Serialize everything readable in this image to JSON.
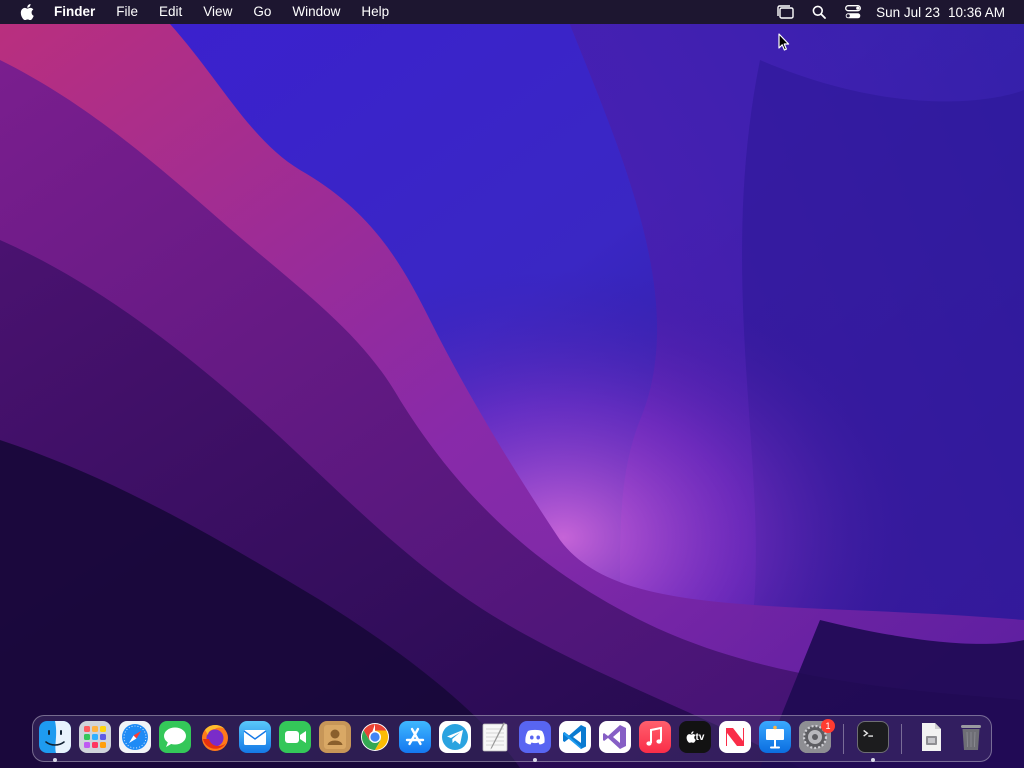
{
  "menubar": {
    "app_name": "Finder",
    "menus": [
      "File",
      "Edit",
      "View",
      "Go",
      "Window",
      "Help"
    ],
    "clock": {
      "date": "Sun Jul 23",
      "time": "10:36 AM"
    }
  },
  "dock": {
    "apps": [
      {
        "name": "Finder",
        "icon": "finder-icon",
        "running": true
      },
      {
        "name": "Launchpad",
        "icon": "launchpad-icon",
        "running": false
      },
      {
        "name": "Safari",
        "icon": "safari-icon",
        "running": false
      },
      {
        "name": "Messages",
        "icon": "messages-icon",
        "running": false
      },
      {
        "name": "Firefox",
        "icon": "firefox-icon",
        "running": false
      },
      {
        "name": "Mail",
        "icon": "mail-icon",
        "running": false
      },
      {
        "name": "FaceTime",
        "icon": "facetime-icon",
        "running": false
      },
      {
        "name": "Contacts",
        "icon": "contacts-icon",
        "running": false
      },
      {
        "name": "Google Chrome",
        "icon": "chrome-icon",
        "running": false
      },
      {
        "name": "App Store",
        "icon": "app-store-icon",
        "running": false
      },
      {
        "name": "Telegram",
        "icon": "telegram-icon",
        "running": false
      },
      {
        "name": "TextEdit",
        "icon": "textedit-icon",
        "running": false
      },
      {
        "name": "Discord",
        "icon": "discord-icon",
        "running": true
      },
      {
        "name": "Visual Studio Code",
        "icon": "vscode-icon",
        "running": false
      },
      {
        "name": "Visual Studio",
        "icon": "visual-studio-icon",
        "running": false
      },
      {
        "name": "Music",
        "icon": "music-icon",
        "running": false
      },
      {
        "name": "TV",
        "icon": "apple-tv-icon",
        "label": "tv",
        "running": false
      },
      {
        "name": "News",
        "icon": "news-icon",
        "running": false
      },
      {
        "name": "Keynote",
        "icon": "keynote-icon",
        "running": false
      },
      {
        "name": "System Settings",
        "icon": "system-settings-icon",
        "badge": "1",
        "running": false
      }
    ],
    "recent_apps": [
      {
        "name": "Terminal",
        "icon": "terminal-icon",
        "running": true
      }
    ],
    "documents": [
      {
        "name": "Downloads",
        "icon": "downloads-stack-icon"
      },
      {
        "name": "Trash",
        "icon": "trash-icon"
      }
    ]
  },
  "colors": {
    "menubar_bg": "#1d1630",
    "wallpaper_top": "#3a22c8",
    "wallpaper_glow": "#c04ad0",
    "badge": "#ff3b30"
  }
}
